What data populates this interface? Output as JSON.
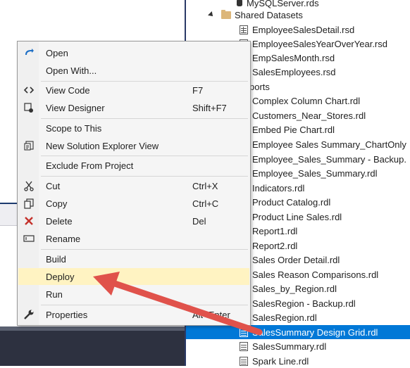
{
  "tree": {
    "items": [
      {
        "label": "MySQLServer.rds",
        "icon": "database-icon"
      },
      {
        "label": "Shared Datasets",
        "icon": "folder-icon"
      },
      {
        "label": "EmployeeSalesDetail.rsd",
        "icon": "dataset-icon"
      },
      {
        "label": "EmployeeSalesYearOverYear.rsd",
        "icon": "dataset-icon"
      },
      {
        "label": "EmpSalesMonth.rsd",
        "icon": "dataset-icon"
      },
      {
        "label": "SalesEmployees.rsd",
        "icon": "dataset-icon"
      },
      {
        "label": "ports",
        "icon": "folder-icon"
      },
      {
        "label": "Complex Column Chart.rdl",
        "icon": "report-icon"
      },
      {
        "label": "Customers_Near_Stores.rdl",
        "icon": "report-icon"
      },
      {
        "label": "Embed Pie Chart.rdl",
        "icon": "report-icon"
      },
      {
        "label": "Employee Sales Summary_ChartOnly",
        "icon": "report-icon"
      },
      {
        "label": "Employee_Sales_Summary - Backup.",
        "icon": "report-icon"
      },
      {
        "label": "Employee_Sales_Summary.rdl",
        "icon": "report-icon"
      },
      {
        "label": "Indicators.rdl",
        "icon": "report-icon"
      },
      {
        "label": "Product Catalog.rdl",
        "icon": "report-icon"
      },
      {
        "label": "Product Line Sales.rdl",
        "icon": "report-icon"
      },
      {
        "label": "Report1.rdl",
        "icon": "report-icon"
      },
      {
        "label": "Report2.rdl",
        "icon": "report-icon"
      },
      {
        "label": "Sales Order Detail.rdl",
        "icon": "report-icon"
      },
      {
        "label": "Sales Reason Comparisons.rdl",
        "icon": "report-icon"
      },
      {
        "label": "Sales_by_Region.rdl",
        "icon": "report-icon"
      },
      {
        "label": "SalesRegion - Backup.rdl",
        "icon": "report-icon"
      },
      {
        "label": "SalesRegion.rdl",
        "icon": "report-icon"
      },
      {
        "label": "SalesSummary Design Grid.rdl",
        "icon": "report-icon",
        "selected": true
      },
      {
        "label": "SalesSummary.rdl",
        "icon": "report-icon"
      },
      {
        "label": "Spark Line.rdl",
        "icon": "report-icon"
      }
    ]
  },
  "menu": {
    "items": [
      {
        "label": "Open",
        "shortcut": "",
        "icon": "open-icon"
      },
      {
        "label": "Open With...",
        "shortcut": "",
        "icon": ""
      },
      {
        "label": "View Code",
        "shortcut": "F7",
        "icon": "code-icon"
      },
      {
        "label": "View Designer",
        "shortcut": "Shift+F7",
        "icon": "designer-icon"
      },
      {
        "label": "Scope to This",
        "shortcut": "",
        "icon": ""
      },
      {
        "label": "New Solution Explorer View",
        "shortcut": "",
        "icon": "new-view-icon"
      },
      {
        "label": "Exclude From Project",
        "shortcut": "",
        "icon": ""
      },
      {
        "label": "Cut",
        "shortcut": "Ctrl+X",
        "icon": "scissors-icon"
      },
      {
        "label": "Copy",
        "shortcut": "Ctrl+C",
        "icon": "copy-icon"
      },
      {
        "label": "Delete",
        "shortcut": "Del",
        "icon": "delete-icon"
      },
      {
        "label": "Rename",
        "shortcut": "",
        "icon": "rename-icon"
      },
      {
        "label": "Build",
        "shortcut": "",
        "icon": ""
      },
      {
        "label": "Deploy",
        "shortcut": "",
        "icon": "",
        "highlighted": true
      },
      {
        "label": "Run",
        "shortcut": "",
        "icon": ""
      },
      {
        "label": "Properties",
        "shortcut": "Alt+Enter",
        "icon": "wrench-icon"
      }
    ]
  },
  "colors": {
    "selection": "#0078d7",
    "highlight": "#fff3c2",
    "arrow": "#e0524b"
  }
}
